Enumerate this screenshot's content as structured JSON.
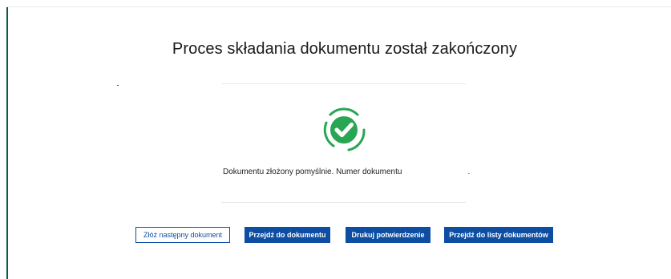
{
  "page": {
    "title": "Proces składania dokumentu został zakończony"
  },
  "status": {
    "message_prefix": "Dokumentu złożony pomyślnie. Numer dokumentu",
    "message_suffix": ".",
    "icon": "check-circle-icon",
    "success_color": "#29a653"
  },
  "actions": {
    "submit_next_label": "Złóż następny dokument",
    "go_to_document_label": "Przejdź do dokumentu",
    "print_confirmation_label": "Drukuj potwierdzenie",
    "go_to_document_list_label": "Przejdź do listy dokumentów"
  },
  "colors": {
    "primary": "#0d4ea3",
    "accent_border": "#0f5a46"
  }
}
